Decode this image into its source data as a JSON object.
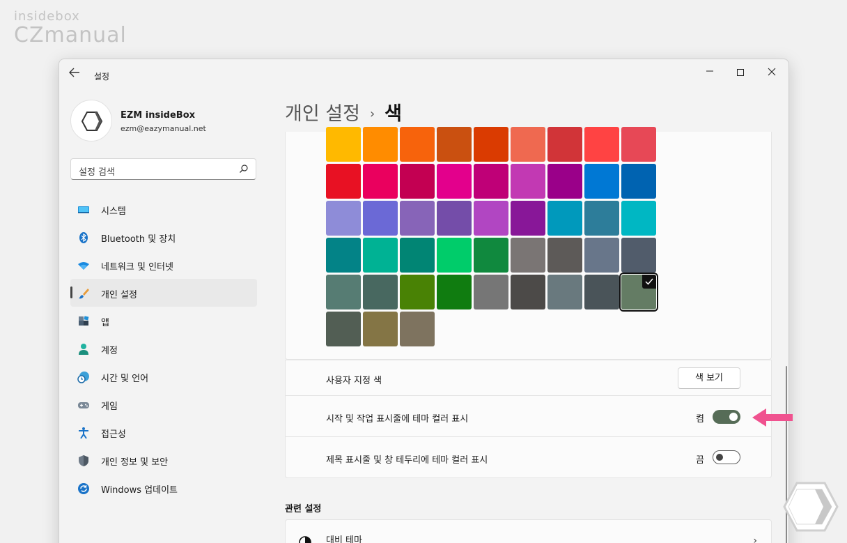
{
  "watermark": {
    "small": "insidebox",
    "big": "CZmanual"
  },
  "window": {
    "title": "설정"
  },
  "profile": {
    "name": "EZM insideBox",
    "email": "ezm@eazymanual.net"
  },
  "search": {
    "placeholder": "설정 검색"
  },
  "nav": {
    "items": [
      {
        "label": "시스템",
        "icon": "monitor-icon"
      },
      {
        "label": "Bluetooth 및 장치",
        "icon": "bluetooth-icon"
      },
      {
        "label": "네트워크 및 인터넷",
        "icon": "wifi-icon"
      },
      {
        "label": "개인 설정",
        "icon": "brush-icon",
        "active": true
      },
      {
        "label": "앱",
        "icon": "apps-icon"
      },
      {
        "label": "계정",
        "icon": "person-icon"
      },
      {
        "label": "시간 및 언어",
        "icon": "clock-globe-icon"
      },
      {
        "label": "게임",
        "icon": "gamepad-icon"
      },
      {
        "label": "접근성",
        "icon": "accessibility-icon"
      },
      {
        "label": "개인 정보 및 보안",
        "icon": "shield-icon"
      },
      {
        "label": "Windows 업데이트",
        "icon": "update-icon"
      }
    ]
  },
  "breadcrumb": {
    "parent": "개인 설정",
    "separator": "›",
    "current": "색"
  },
  "colors": {
    "selected_index": 44,
    "swatches": [
      "#ffb900",
      "#ff8c00",
      "#f7630c",
      "#ca5010",
      "#da3b01",
      "#ef6950",
      "#d13438",
      "#ff4343",
      "#e74856",
      "#e81123",
      "#ea005e",
      "#c30052",
      "#e3008c",
      "#bf0077",
      "#c239b3",
      "#9a0089",
      "#0078d4",
      "#0063b1",
      "#8e8cd8",
      "#6b69d6",
      "#8764b8",
      "#744da9",
      "#b146c2",
      "#881798",
      "#0099bc",
      "#2d7d9a",
      "#00b7c3",
      "#038387",
      "#00b294",
      "#018574",
      "#00cc6a",
      "#10893e",
      "#7a7574",
      "#5d5a58",
      "#68768a",
      "#515c6b",
      "#567c73",
      "#486860",
      "#498205",
      "#107c10",
      "#767676",
      "#4c4a48",
      "#69797e",
      "#4a5459",
      "#647c64",
      "#525e54",
      "#847545",
      "#7e735f"
    ]
  },
  "custom_color": {
    "label": "사용자 지정 색",
    "button": "색 보기"
  },
  "taskbar_accent": {
    "label": "시작 및 작업 표시줄에 테마 컬러 표시",
    "state": "켬",
    "on": true
  },
  "titlebar_accent": {
    "label": "제목 표시줄 및 창 테두리에 테마 컬러 표시",
    "state": "끔",
    "on": false
  },
  "related": {
    "title": "관련 설정",
    "contrast_label": "대비 테마",
    "contrast_icon": "contrast-icon"
  },
  "accent_colors": {
    "toggle_on": "#566c57",
    "annotation_arrow": "#f0528f"
  }
}
